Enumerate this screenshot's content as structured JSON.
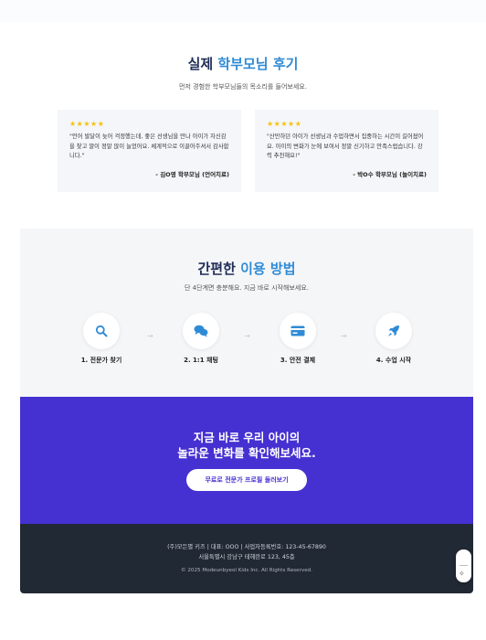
{
  "reviews": {
    "title_prefix": "실제 ",
    "title_accent": "학부모님 후기",
    "subtitle": "먼저 경험한 학부모님들의 목소리를 들어보세요.",
    "items": [
      {
        "stars": "★★★★★",
        "quote": "\"언어 발달이 늦어 걱정했는데, 좋은 선생님을 만나 아이가 자신감을 찾고 말이 정말 많이 늘었어요. 체계적으로 이끌어주셔서 감사합니다.\"",
        "author": "- 김O영 학부모님 (언어치료)"
      },
      {
        "stars": "★★★★★",
        "quote": "\"산만하던 아이가 선생님과 수업하면서 집중하는 시간이 길어졌어요. 아이의 변화가 눈에 보여서 정말 신기하고 만족스럽습니다. 강력 추천해요!\"",
        "author": "- 박O수 학부모님 (놀이치료)"
      }
    ]
  },
  "howto": {
    "title_prefix": "간편한 ",
    "title_accent": "이용 방법",
    "subtitle": "단 4단계면 충분해요. 지금 바로 시작해보세요.",
    "steps": [
      {
        "label": "1. 전문가 찾기",
        "icon": "search-icon"
      },
      {
        "label": "2. 1:1 채팅",
        "icon": "chat-icon"
      },
      {
        "label": "3. 안전 결제",
        "icon": "card-icon"
      },
      {
        "label": "4. 수업 시작",
        "icon": "rocket-icon"
      }
    ],
    "arrow": "→"
  },
  "cta": {
    "line1": "지금 바로 우리 아이의",
    "line2": "놀라운 변화를 확인해보세요.",
    "button": "무료로 전문가 프로필 둘러보기"
  },
  "footer": {
    "line1": "(주)모든별 키즈 | 대표: OOO | 사업자등록번호: 123-45-67890",
    "line2": "서울특별시 강남구 테헤란로 123, 45층",
    "copyright": "© 2025 Modeunbyeol Kids Inc. All Rights Reserved."
  },
  "colors": {
    "accent_blue": "#2f8bd6",
    "navy": "#1f2d57",
    "cta_purple": "#4530d1",
    "footer_dark": "#212934",
    "star": "#f4c20d"
  }
}
